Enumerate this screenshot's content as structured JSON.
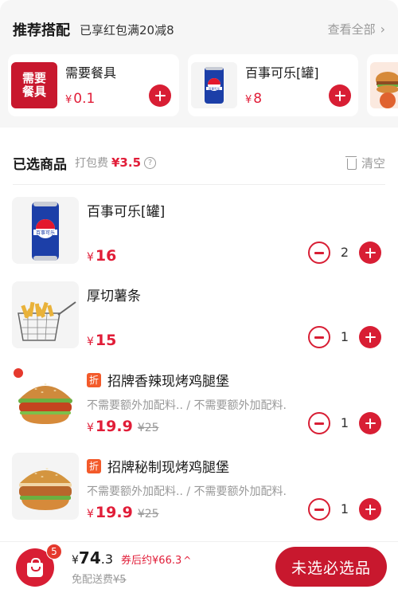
{
  "recommend": {
    "title": "推荐搭配",
    "subtitle": "已享红包满20减8",
    "more_label": "查看全部",
    "items": [
      {
        "name": "需要餐具",
        "icon_text_1": "需要",
        "icon_text_2": "餐具",
        "currency": "¥",
        "price": "0.1"
      },
      {
        "name": "百事可乐[罐]",
        "can_label": "百事可乐",
        "currency": "¥",
        "price": "8"
      }
    ]
  },
  "selected": {
    "title": "已选商品",
    "packing_label": "打包费",
    "packing_price": "¥3.5",
    "help_icon": "?",
    "clear_label": "清空",
    "items": [
      {
        "name": "百事可乐[罐]",
        "can_label": "百事可乐",
        "currency": "¥",
        "price": "16",
        "qty": "2"
      },
      {
        "name": "厚切薯条",
        "currency": "¥",
        "price": "15",
        "qty": "1"
      },
      {
        "discount_tag": "折",
        "name": "招牌香辣现烤鸡腿堡",
        "spec": "不需要额外加配料.. / 不需要额外加配料.",
        "currency": "¥",
        "price": "19.9",
        "original_price": "¥25",
        "qty": "1"
      },
      {
        "discount_tag": "折",
        "name": "招牌秘制现烤鸡腿堡",
        "spec": "不需要额外加配料.. / 不需要额外加配料.",
        "currency": "¥",
        "price": "19.9",
        "original_price": "¥25",
        "qty": "1"
      }
    ]
  },
  "bottom": {
    "badge_count": "5",
    "currency": "¥",
    "total_int": "74",
    "total_dec": ".3",
    "coupon_text": "券后约¥66.3",
    "caret": "^",
    "free_label": "免配送费",
    "free_old_price": "¥5",
    "checkout_label": "未选必选品"
  },
  "colors": {
    "accent": "#d81e34",
    "price": "#e11d38"
  }
}
